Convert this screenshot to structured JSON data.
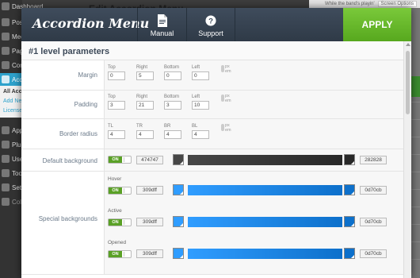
{
  "wp": {
    "bg_title": "Edit Accordion Menu",
    "menu": [
      "Dashboard",
      "Posts",
      "Media",
      "Pages",
      "Comments",
      "Accordion"
    ],
    "submenu": [
      "All Acc",
      "Add New",
      "License"
    ],
    "menu2": [
      "Appearance",
      "Plugins",
      "Users",
      "Tools",
      "Settings",
      "Collapse"
    ],
    "top_right": "While the band's playin'",
    "screen_options": "Screen Options"
  },
  "header": {
    "brand": "Accordion Menu",
    "manual_label": "Manual",
    "support_label": "Support",
    "apply_label": "APPLY"
  },
  "section": {
    "title": "#1 level parameters"
  },
  "margin": {
    "label": "Margin",
    "fields": [
      {
        "label": "Top",
        "value": "0"
      },
      {
        "label": "Right",
        "value": "5"
      },
      {
        "label": "Bottom",
        "value": "0"
      },
      {
        "label": "Left",
        "value": "0"
      }
    ],
    "units": [
      "px",
      "em"
    ]
  },
  "padding": {
    "label": "Padding",
    "fields": [
      {
        "label": "Top",
        "value": "3"
      },
      {
        "label": "Right",
        "value": "21"
      },
      {
        "label": "Bottom",
        "value": "3"
      },
      {
        "label": "Left",
        "value": "10"
      }
    ],
    "units": [
      "px",
      "em"
    ]
  },
  "radius": {
    "label": "Border radius",
    "fields": [
      {
        "label": "TL",
        "value": "4"
      },
      {
        "label": "TR",
        "value": "4"
      },
      {
        "label": "BR",
        "value": "4"
      },
      {
        "label": "BL",
        "value": "4"
      }
    ],
    "units": [
      "px",
      "em"
    ]
  },
  "default_bg": {
    "label": "Default background",
    "toggle": "ON",
    "start_hex": "474747",
    "end_hex": "282828",
    "start_color": "#474747",
    "end_color": "#282828"
  },
  "special_bg": {
    "label": "Special backgrounds",
    "items": [
      {
        "label": "Hover",
        "toggle": "ON",
        "start_hex": "309dff",
        "end_hex": "0d70cb",
        "start_color": "#309dff",
        "end_color": "#0d70cb"
      },
      {
        "label": "Active",
        "toggle": "ON",
        "start_hex": "309dff",
        "end_hex": "0d70cb",
        "start_color": "#309dff",
        "end_color": "#0d70cb"
      },
      {
        "label": "Opened",
        "toggle": "ON",
        "start_hex": "309dff",
        "end_hex": "0d70cb",
        "start_color": "#309dff",
        "end_color": "#0d70cb"
      }
    ]
  }
}
